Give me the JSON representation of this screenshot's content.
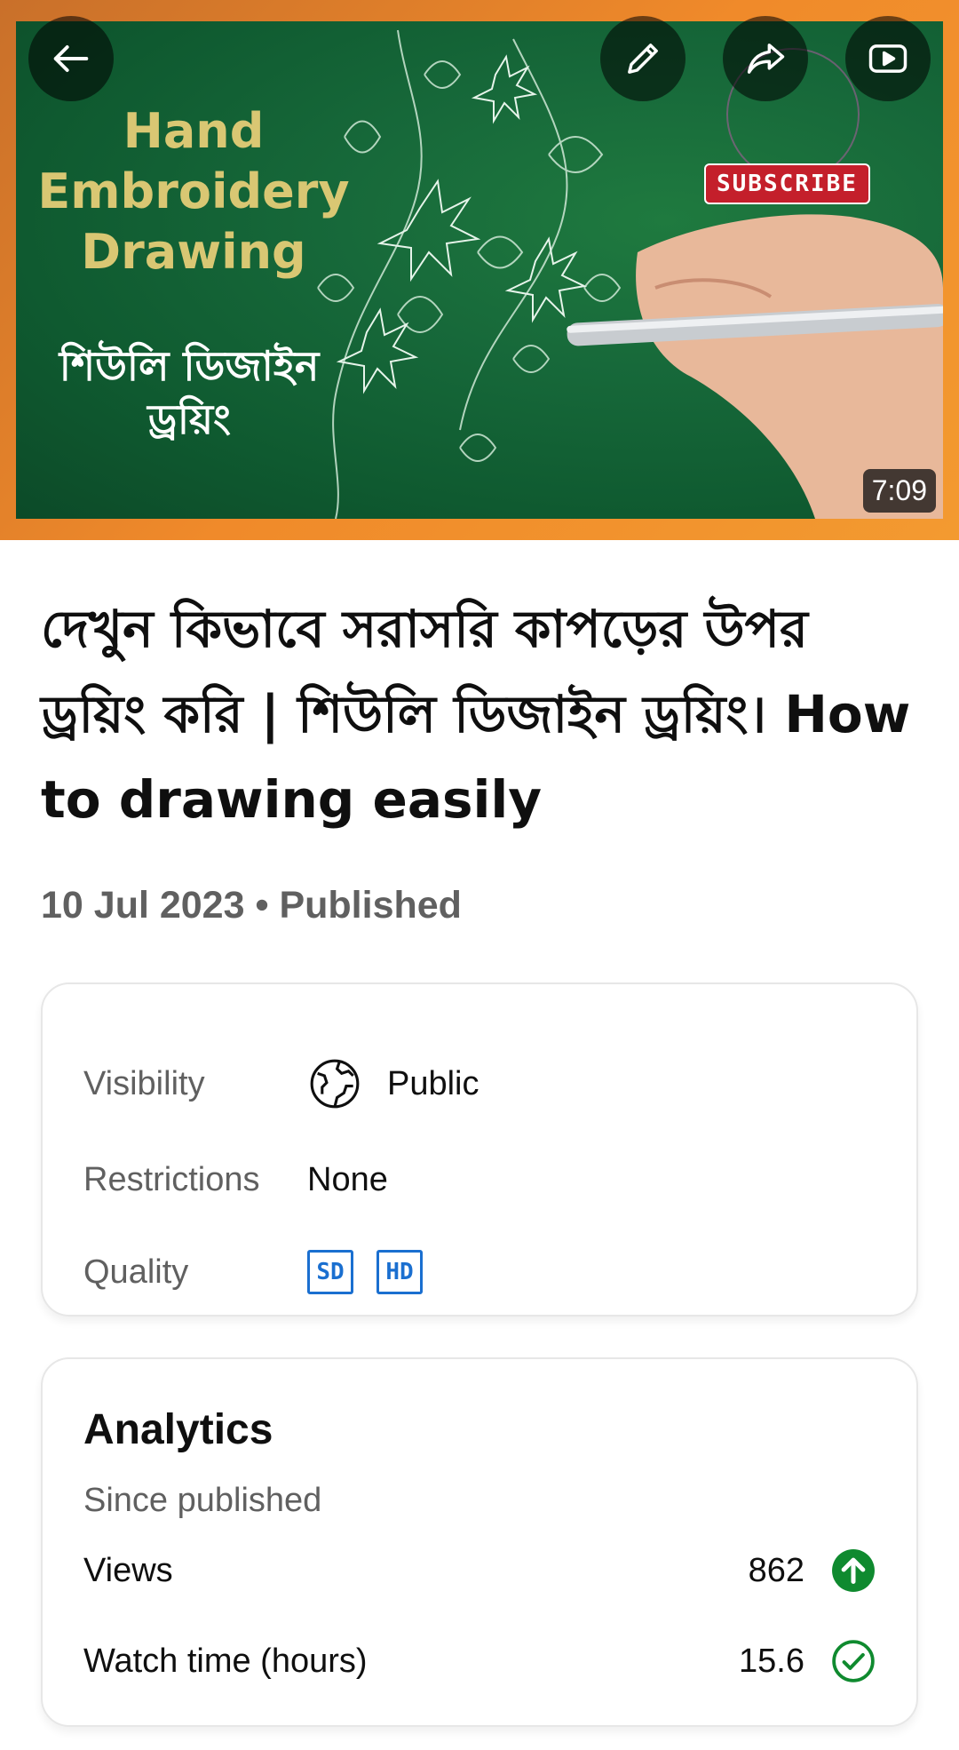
{
  "thumbnail": {
    "title_lines": [
      "Hand",
      "Embroidery",
      "Drawing"
    ],
    "subtitle_lines": [
      "শিউলি ডিজাইন",
      "ড্রয়িং"
    ],
    "subscribe_label": "SUBSCRIBE",
    "duration": "7:09"
  },
  "video": {
    "title": "দেখুন কিভাবে সরাসরি কাপড়ের উপর ড্রয়িং করি | শিউলি ডিজাইন ড্রয়িং। How to drawing easily",
    "meta": "10 Jul 2023 • Published"
  },
  "details": {
    "visibility_label": "Visibility",
    "visibility_value": "Public",
    "restrictions_label": "Restrictions",
    "restrictions_value": "None",
    "quality_label": "Quality",
    "quality_badges": [
      "SD",
      "HD"
    ]
  },
  "analytics": {
    "title": "Analytics",
    "subtitle": "Since published",
    "views_label": "Views",
    "views_value": "862",
    "watch_label": "Watch time (hours)",
    "watch_value": "15.6"
  },
  "colors": {
    "accent_green": "#0f8a2f",
    "quality_blue": "#1a6fd0",
    "thumbnail_border": "#f08a2a"
  },
  "icons": [
    "back-arrow-icon",
    "edit-pencil-icon",
    "share-icon",
    "youtube-play-icon",
    "globe-icon",
    "arrow-up-icon",
    "check-circle-icon"
  ]
}
